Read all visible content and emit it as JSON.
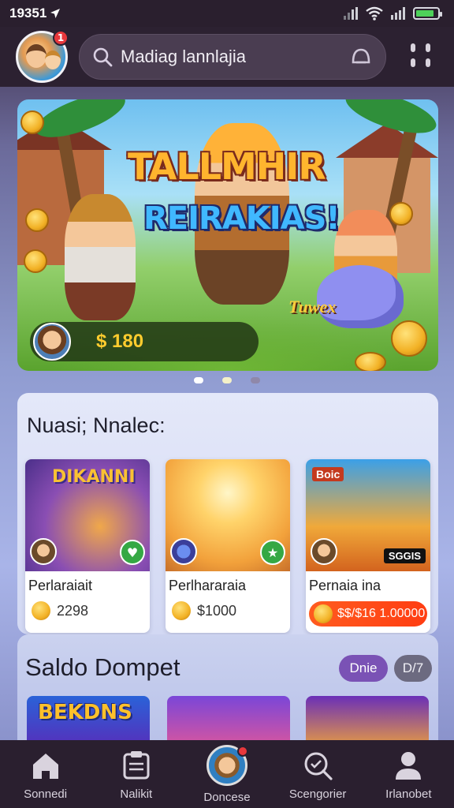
{
  "status_bar": {
    "time": "19351",
    "battery_level": 0.85
  },
  "header": {
    "avatar_badge": "1",
    "search_text": "Madiag  lannlajia"
  },
  "hero": {
    "title_line1": "TALLMHIR",
    "title_line2": "REIRAKIAS!",
    "tag": "Tuwex",
    "amount": "$ 180",
    "carousel_active_index": 0,
    "carousel_count": 3
  },
  "section": {
    "title": "Nuasi; Nnalec:",
    "cards": [
      {
        "banner": "DIKANNI",
        "name": "Perlaraiait",
        "price": "2298",
        "badge_icon": "heart-icon",
        "style": "plain"
      },
      {
        "banner": "",
        "name": "Perlhararaia",
        "price": "$1000",
        "badge_icon": "star-icon",
        "style": "plain"
      },
      {
        "top_tag": "Boic",
        "corner_text": "SGGIS",
        "name": "Pernaia ina",
        "price": "$$/$16 1.00000",
        "style": "pill"
      }
    ]
  },
  "wallet": {
    "title": "Saldo Dompet",
    "chip_primary": "Dnie",
    "chip_secondary": "D/7",
    "thumbs": [
      {
        "text": "BEKDNS"
      },
      {
        "text": ""
      },
      {
        "text": ""
      }
    ]
  },
  "bottom_nav": {
    "items": [
      {
        "label": "Sonnedi",
        "icon": "home-icon"
      },
      {
        "label": "Nalikit",
        "icon": "clipboard-icon"
      },
      {
        "label": "Doncese",
        "icon": "profile-avatar-icon"
      },
      {
        "label": "Scengorier",
        "icon": "chat-search-icon"
      },
      {
        "label": "Irlanobet",
        "icon": "user-icon"
      }
    ]
  },
  "colors": {
    "accent_purple": "#7a52b5",
    "price_orange": "#ff4a16",
    "badge_red": "#e8383c",
    "gold": "#ffcc2e"
  }
}
